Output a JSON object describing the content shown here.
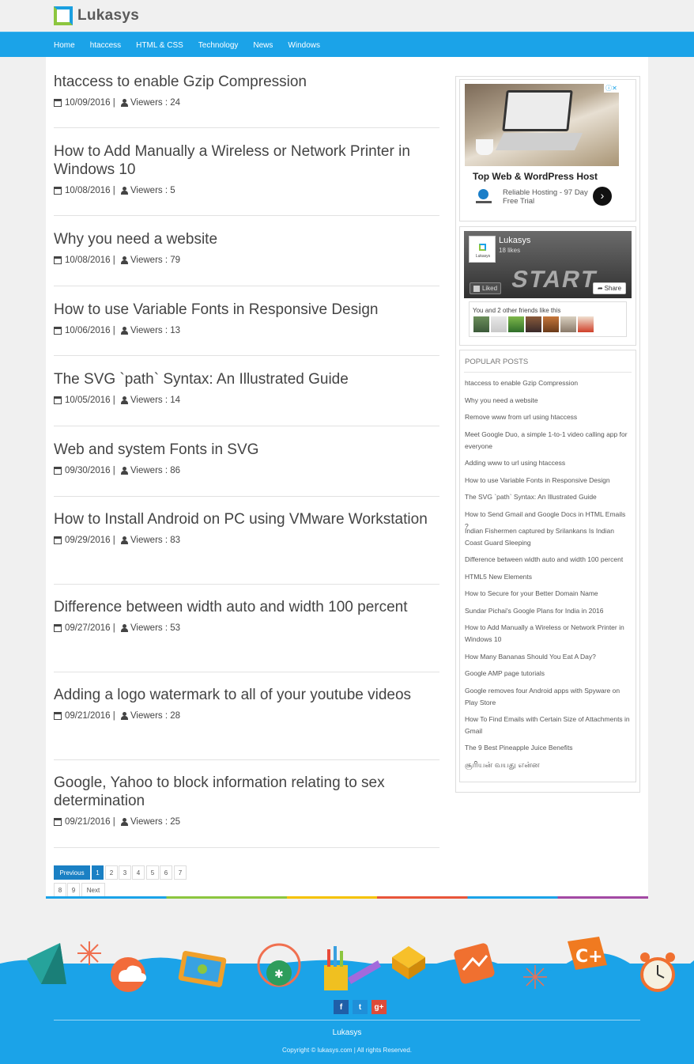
{
  "brand": {
    "name": "Lukasys"
  },
  "nav": [
    "Home",
    "htaccess",
    "HTML & CSS",
    "Technology",
    "News",
    "Windows"
  ],
  "posts": [
    {
      "title": "htaccess to enable Gzip Compression",
      "date": "10/09/2016",
      "viewers": "Viewers : 24"
    },
    {
      "title": "How to Add Manually a Wireless or Network Printer in Windows 10",
      "date": "10/08/2016",
      "viewers": "Viewers : 5"
    },
    {
      "title": "Why you need a website",
      "date": "10/08/2016",
      "viewers": "Viewers : 79"
    },
    {
      "title": "How to use Variable Fonts in Responsive Design",
      "date": "10/06/2016",
      "viewers": "Viewers : 13"
    },
    {
      "title": "The SVG `path` Syntax: An Illustrated Guide",
      "date": "10/05/2016",
      "viewers": "Viewers : 14"
    },
    {
      "title": "Web and system Fonts in SVG",
      "date": "09/30/2016",
      "viewers": "Viewers : 86"
    },
    {
      "title": "How to Install Android on PC using VMware Workstation",
      "date": "09/29/2016",
      "viewers": "Viewers : 83"
    },
    {
      "title": "Difference between width auto and width 100 percent",
      "date": "09/27/2016",
      "viewers": "Viewers : 53"
    },
    {
      "title": "Adding a logo watermark to all of your youtube videos",
      "date": "09/21/2016",
      "viewers": "Viewers : 28"
    },
    {
      "title": "Google, Yahoo to block information relating to sex determination",
      "date": "09/21/2016",
      "viewers": "Viewers : 25"
    }
  ],
  "pagination": {
    "previous": "Previous",
    "pages": [
      "1",
      "2",
      "3",
      "4",
      "5",
      "6",
      "7",
      "8",
      "9"
    ],
    "current": "1",
    "next": "Next"
  },
  "ad": {
    "close": "ⓘ✕",
    "title": "Top Web & WordPress Host",
    "subtitle": "Reliable Hosting - 97 Day Free Trial",
    "logo_text": "DreamHost",
    "go": "›"
  },
  "facebook": {
    "page_name": "Lukasys",
    "likes": "18 likes",
    "thumb_label": "Lukasys",
    "liked_label": "Liked",
    "share_label": "Share",
    "friends_text": "You and 2 other friends like this",
    "cover_text": "START"
  },
  "popular": {
    "heading": "POPULAR POSTS",
    "items": [
      "htaccess to enable Gzip Compression",
      "Why you need a website",
      "Remove www from url using htaccess",
      "Meet Google Duo, a simple 1-to-1 video calling app for everyone",
      "Adding www to url using htaccess",
      "How to use Variable Fonts in Responsive Design",
      "The SVG `path` Syntax: An Illustrated Guide",
      "How to Send Gmail and Google Docs in HTML Emails ?",
      "Indian Fishermen captured by Srilankans Is Indian Coast Guard Sleeping",
      "Difference between width auto and width 100 percent",
      "HTML5 New Elements",
      "How to Secure for your Better Domain Name",
      "Sundar Pichai's Google Plans for India in 2016",
      "How to Add Manually a Wireless or Network Printer in Windows 10",
      "How Many Bananas Should You Eat A Day?",
      "Google AMP page tutorials",
      "Google removes four Android apps with Spyware on Play Store",
      "How To Find Emails with Certain Size of Attachments in Gmail",
      "The 9 Best Pineapple Juice Benefits",
      "சூரியன் வயது என்ன"
    ]
  },
  "social": {
    "facebook": "f",
    "twitter": "t",
    "google": "g+"
  },
  "footer": {
    "brand": "Lukasys",
    "copyright": "Copyright © lukasys.com  |  All rights Reserved."
  },
  "colors": {
    "accent": "#1ba3e8",
    "brand_green": "#8cc63f",
    "pager_active": "#1a80c4",
    "google_red": "#dd4b39",
    "facebook_blue": "#3b5998"
  }
}
